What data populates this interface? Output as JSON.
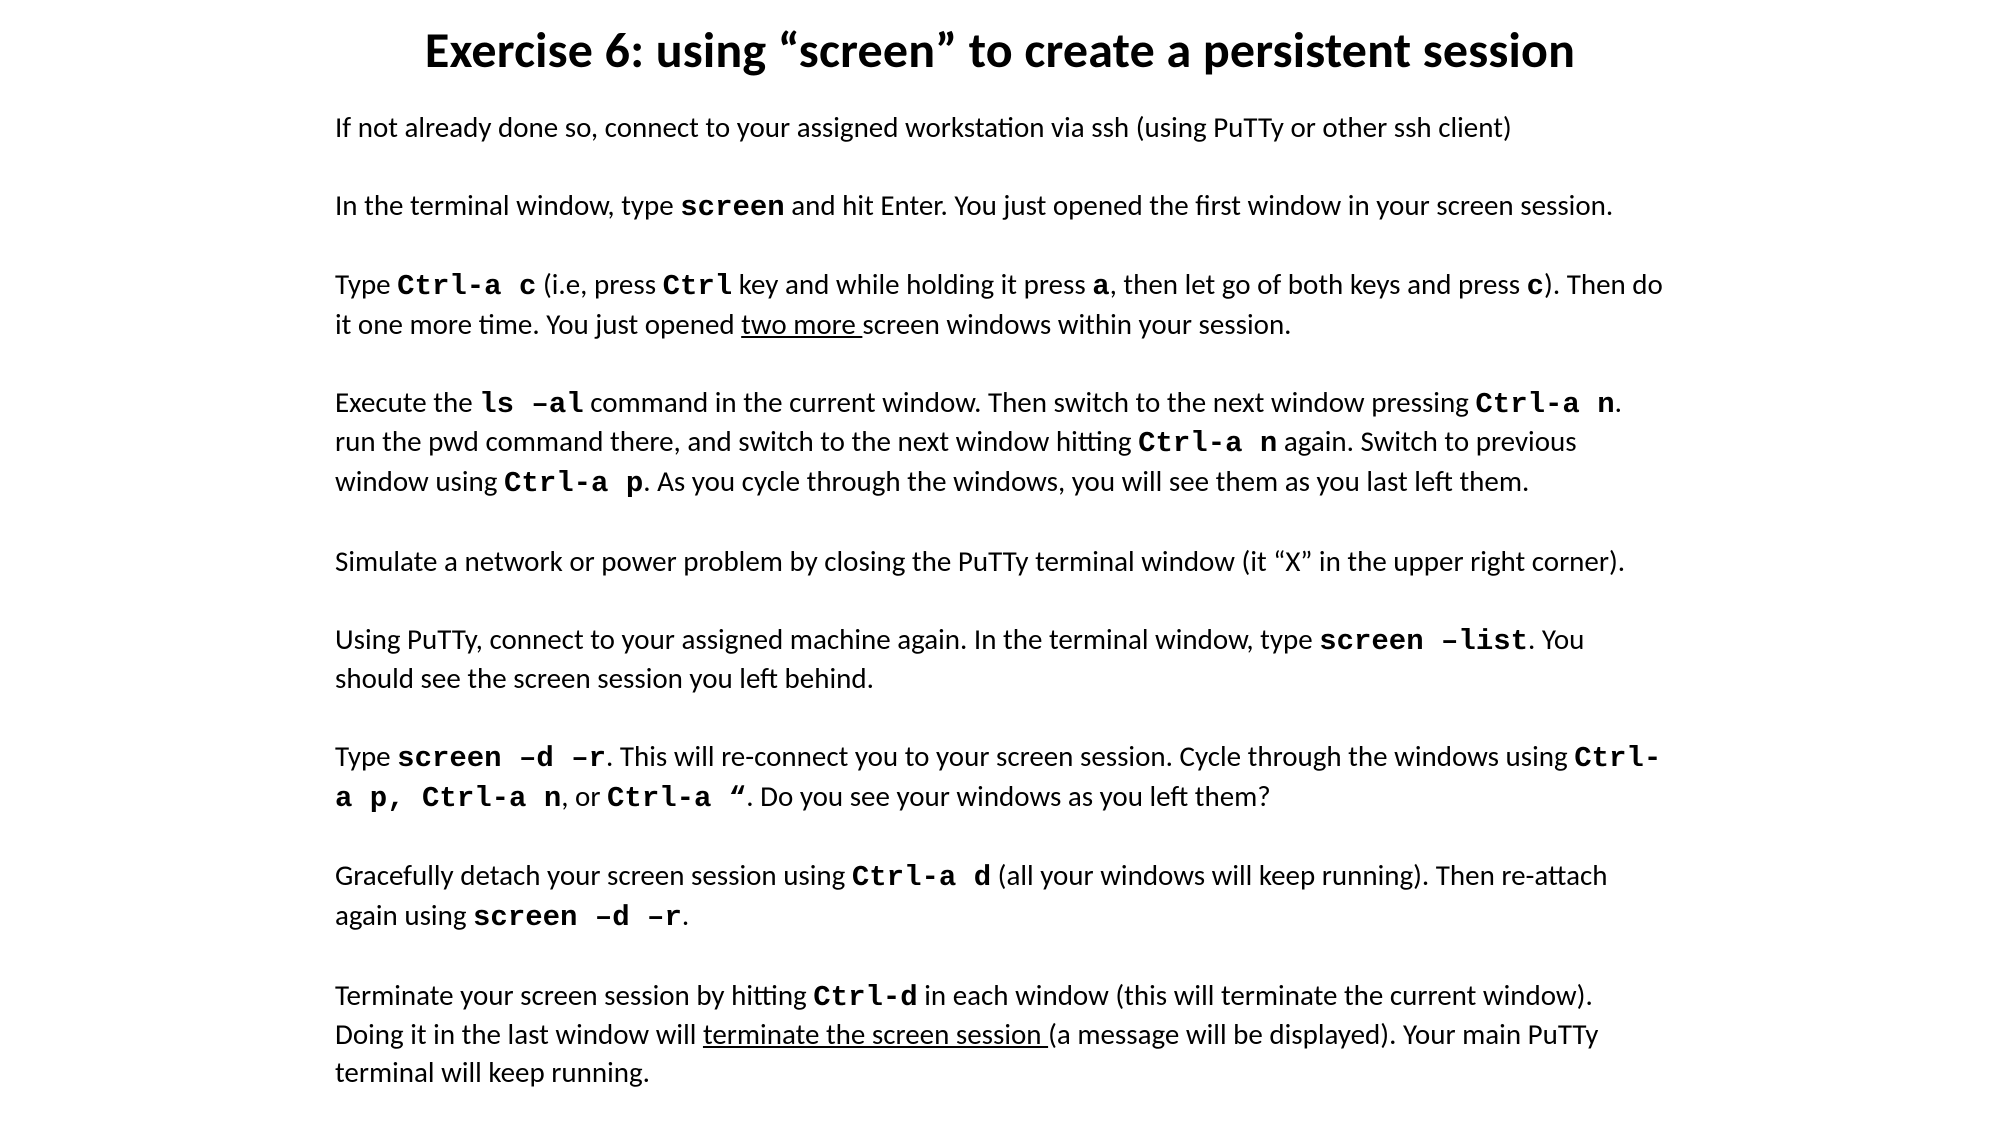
{
  "title": "Exercise 6: using “screen” to create a persistent session",
  "p1": {
    "t1": "If not already done so, connect to your assigned workstation via ssh (using PuTTy or other ssh client)"
  },
  "p2": {
    "t1": "In the terminal window, type ",
    "c1": "screen",
    "t2": " and hit Enter. You just opened the first window in your screen session."
  },
  "p3": {
    "t1": "Type ",
    "c1": "Ctrl-a c",
    "t2": " (i.e, press ",
    "c2": "Ctrl",
    "t3": " key and while holding it press ",
    "c3": "a",
    "t4": ", then let go of both keys and press ",
    "c4": "c",
    "t5": "). Then do it one more time. You just opened ",
    "u1": "two more ",
    "t6": "screen windows within your session."
  },
  "p4": {
    "t1": "Execute the ",
    "c1": "ls –al",
    "t2": " command in the current window. Then switch to the next window pressing ",
    "c2": "Ctrl-a n",
    "t3": ". run  the pwd command there, and switch to the next window hitting ",
    "c3": "Ctrl-a n",
    "t4": " again. Switch to previous window using ",
    "c4": "Ctrl-a p",
    "t5": ". As you cycle through the windows, you will see them as you last left them."
  },
  "p5": {
    "t1": "Simulate a network or power problem by closing the PuTTy terminal window (it “X” in the upper right corner)."
  },
  "p6": {
    "t1": "Using PuTTy, connect to your assigned machine again. In the terminal window, type ",
    "c1": "screen –list",
    "t2": ". You should see the screen session you left behind."
  },
  "p7": {
    "t1": "Type ",
    "c1": "screen –d –r",
    "t2": ". This will re-connect you to your screen session. Cycle through the windows using ",
    "c2": "Ctrl-a p, Ctrl-a n",
    "t3": ", or ",
    "c3": "Ctrl-a “",
    "t4": ". Do you see your windows as you left them?"
  },
  "p8": {
    "t1": "Gracefully detach your screen session using ",
    "c1": "Ctrl-a d",
    "t2": " (all your windows will keep running). Then re-attach again using ",
    "c2": "screen –d –r",
    "t3": "."
  },
  "p9": {
    "t1": "Terminate your screen session by hitting ",
    "c1": "Ctrl-d",
    "t2": " in each window (this will terminate the current window). Doing it in the last window will ",
    "u1": "terminate the screen session ",
    "t3": "(a message will be displayed). Your main PuTTy terminal will keep running."
  }
}
